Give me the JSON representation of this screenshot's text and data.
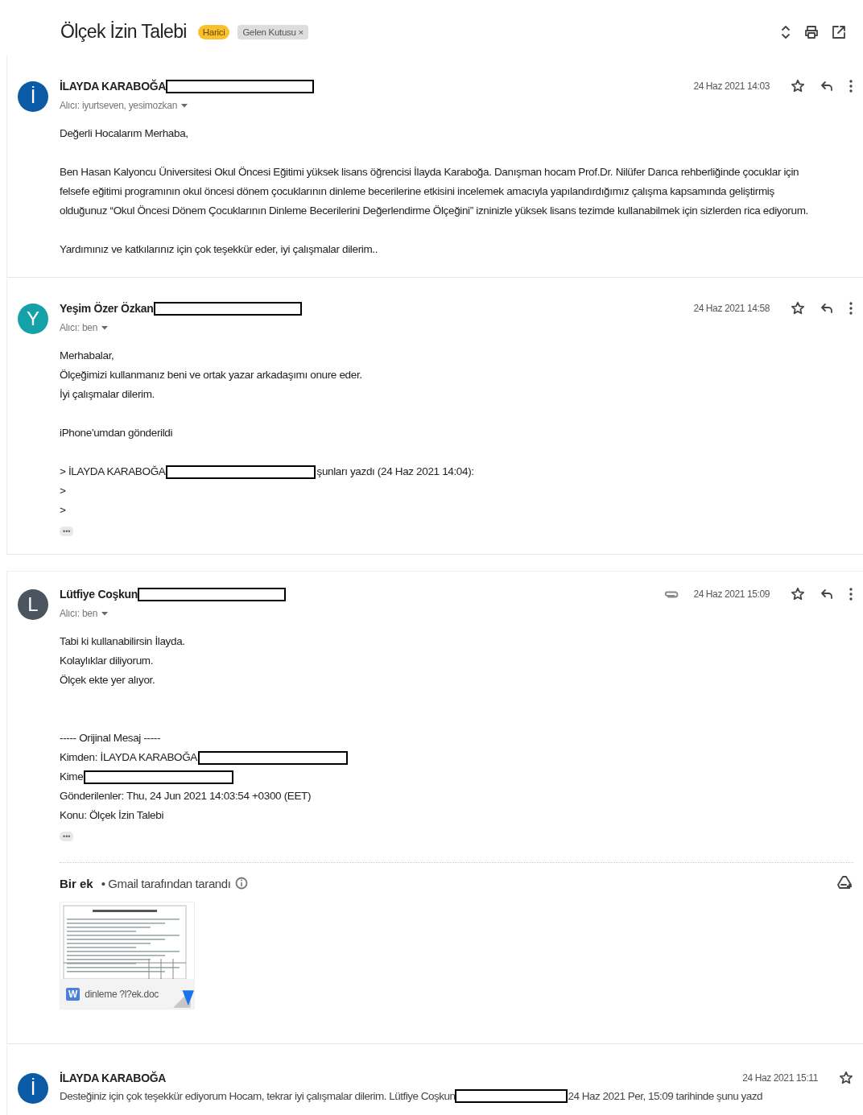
{
  "thread": {
    "subject": "Ölçek İzin Talebi",
    "labels": [
      {
        "text": "Harici",
        "kind": "external",
        "removable": false
      },
      {
        "text": "Gelen Kutusu",
        "kind": "inbox",
        "removable": true,
        "remove_mark": "×"
      }
    ]
  },
  "panels": [
    {
      "messages": [
        {
          "kind": "expanded",
          "avatar": "İ",
          "color": "#0b5aa5",
          "sender": "İLAYDA KARABOĞA",
          "redacted": true,
          "recipient": "Alıcı: iyurtseven, yesimozkan",
          "date": "24 Haz 2021 14:03",
          "attachment": false,
          "starred": false,
          "body": [
            {
              "kind": "text",
              "text": "Değerli Hocalarım Merhaba,"
            },
            {
              "kind": "blank"
            },
            {
              "kind": "text",
              "text": "Ben Hasan Kalyoncu Üniversitesi Okul Öncesi Eğitimi yüksek lisans öğrencisi İlayda Karaboğa. Danışman hocam Prof.Dr. Nilüfer Darıca rehberliğinde çocuklar için felsefe eğitimi programının okul öncesi dönem çocuklarının dinleme becerilerine etkisini incelemek amacıyla yapılandırdığımız çalışma kapsamında geliştirmiş olduğunuz  “Okul Öncesi Dönem Çocuklarının Dinleme Becerilerini Değerlendirme Ölçeğini” izninizle yüksek lisans tezimde kullanabilmek için sizlerden rica ediyorum."
            },
            {
              "kind": "blank"
            },
            {
              "kind": "text",
              "text": "Yardımınız ve katkılarınız için çok teşekkür eder, iyi çalışmalar dilerim.."
            }
          ]
        },
        {
          "kind": "expanded",
          "avatar": "Y",
          "color": "#14a2a8",
          "sender": "Yeşim Özer Özkan",
          "redacted": true,
          "recipient": "Alıcı: ben",
          "date": "24 Haz 2021 14:58",
          "attachment": false,
          "starred": false,
          "body": [
            {
              "kind": "text",
              "text": "Merhabalar,"
            },
            {
              "kind": "text",
              "text": "Ölçeğimizi kullanmanız beni ve ortak yazar arkadaşımı onure eder."
            },
            {
              "kind": "text",
              "text": "İyi çalışmalar dilerim."
            },
            {
              "kind": "blank"
            },
            {
              "kind": "text",
              "text": "iPhone'umdan gönderildi"
            },
            {
              "kind": "blank"
            },
            {
              "kind": "redacted",
              "before": "> İLAYDA KARABOĞA",
              "after": "şunları yazdı (24 Haz 2021 14:04):"
            },
            {
              "kind": "text",
              "text": ">"
            },
            {
              "kind": "text",
              "text": ">"
            },
            {
              "kind": "more",
              "text": "•••"
            }
          ]
        }
      ]
    },
    {
      "messages": [
        {
          "kind": "expanded",
          "avatar": "L",
          "color": "#4a5560",
          "sender": "Lütfiye Coşkun",
          "redacted": true,
          "recipient": "Alıcı: ben",
          "date": "24 Haz 2021 15:09",
          "attachment": true,
          "starred": false,
          "body": [
            {
              "kind": "text",
              "text": "Tabi ki kullanabilirsin İlayda."
            },
            {
              "kind": "text",
              "text": "Kolaylıklar diliyorum."
            },
            {
              "kind": "text",
              "text": "Ölçek ekte yer alıyor."
            },
            {
              "kind": "blank"
            },
            {
              "kind": "blank"
            },
            {
              "kind": "text",
              "text": "----- Orijinal Mesaj -----"
            },
            {
              "kind": "redacted",
              "before": "Kimden: İLAYDA KARABOĞA"
            },
            {
              "kind": "redacted",
              "before": "Kime"
            },
            {
              "kind": "text",
              "text": "Gönderilenler: Thu, 24 Jun 2021 14:03:54 +0300 (EET)"
            },
            {
              "kind": "text",
              "text": "Konu: Ölçek İzin Talebi"
            },
            {
              "kind": "more",
              "text": "•••"
            }
          ],
          "attachments_section": {
            "title": "Bir ek",
            "scan_note": "• Gmail tarafından tarandı",
            "files": [
              {
                "type_badge": "W",
                "name": "dinleme ?l?ek.doc"
              }
            ]
          }
        },
        {
          "kind": "collapsed",
          "avatar": "İ",
          "color": "#0b5aa5",
          "sender": "İLAYDA KARABOĞA",
          "date": "24 Haz 2021 15:11",
          "starred": false,
          "snippet_before": "Desteğiniz için çok teşekkür ediyorum Hocam, tekrar iyi çalışmalar dilerim. Lütfiye Coşkun",
          "snippet_after": "24 Haz 2021 Per, 15:09 tarihinde şunu yazd"
        }
      ]
    }
  ]
}
